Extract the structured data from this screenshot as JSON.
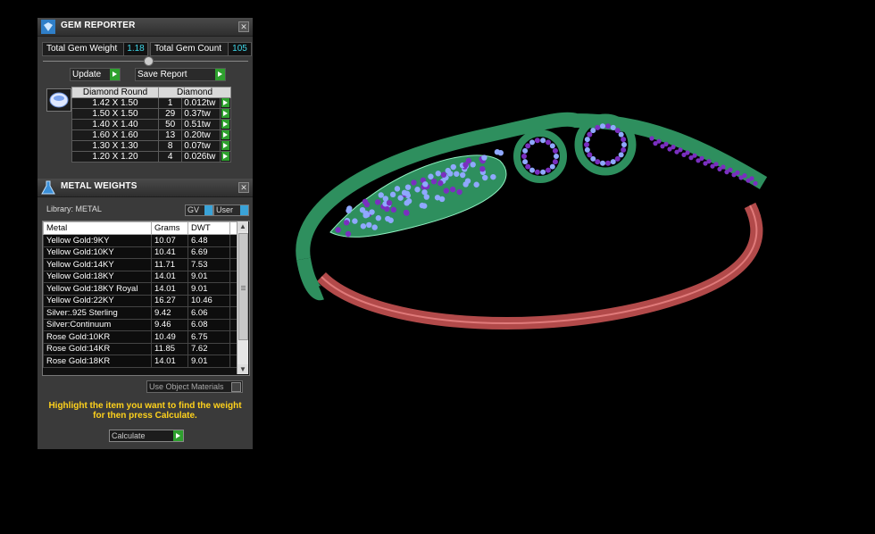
{
  "gem_reporter": {
    "title": "GEM REPORTER",
    "total_weight_label": "Total Gem Weight",
    "total_weight_value": "1.18",
    "total_count_label": "Total Gem Count",
    "total_count_value": "105",
    "update_label": "Update",
    "save_report_label": "Save Report",
    "columns": [
      "Diamond Round",
      "Diamond"
    ],
    "rows": [
      {
        "size": "1.42 X 1.50",
        "count": "1",
        "weight": "0.012tw"
      },
      {
        "size": "1.50 X 1.50",
        "count": "29",
        "weight": "0.37tw"
      },
      {
        "size": "1.40 X 1.40",
        "count": "50",
        "weight": "0.51tw"
      },
      {
        "size": "1.60 X 1.60",
        "count": "13",
        "weight": "0.20tw"
      },
      {
        "size": "1.30 X 1.30",
        "count": "8",
        "weight": "0.07tw"
      },
      {
        "size": "1.20 X 1.20",
        "count": "4",
        "weight": "0.026tw"
      }
    ]
  },
  "metal_weights": {
    "title": "METAL WEIGHTS",
    "library_label": "Library: METAL",
    "gv_label": "GV",
    "user_label": "User",
    "columns": [
      "Metal",
      "Grams",
      "DWT"
    ],
    "rows": [
      {
        "metal": "Yellow Gold:9KY",
        "grams": "10.07",
        "dwt": "6.48"
      },
      {
        "metal": "Yellow Gold:10KY",
        "grams": "10.41",
        "dwt": "6.69"
      },
      {
        "metal": "Yellow Gold:14KY",
        "grams": "11.71",
        "dwt": "7.53"
      },
      {
        "metal": "Yellow Gold:18KY",
        "grams": "14.01",
        "dwt": "9.01"
      },
      {
        "metal": "Yellow Gold:18KY Royal",
        "grams": "14.01",
        "dwt": "9.01"
      },
      {
        "metal": "Yellow Gold:22KY",
        "grams": "16.27",
        "dwt": "10.46"
      },
      {
        "metal": "Silver:.925 Sterling",
        "grams": "9.42",
        "dwt": "6.06"
      },
      {
        "metal": "Silver:Continuum",
        "grams": "9.46",
        "dwt": "6.08"
      },
      {
        "metal": "Rose Gold:10KR",
        "grams": "10.49",
        "dwt": "6.75"
      },
      {
        "metal": "Rose Gold:14KR",
        "grams": "11.85",
        "dwt": "7.62"
      },
      {
        "metal": "Rose Gold:18KR",
        "grams": "14.01",
        "dwt": "9.01"
      }
    ],
    "use_object_materials_label": "Use Object Materials",
    "hint": "Highlight the item you want to find the weight for then press Calculate.",
    "calculate_label": "Calculate"
  },
  "colors": {
    "accent_cyan": "#3fd6e8",
    "go_green": "#2ea02e",
    "hint_yellow": "#ffd21c",
    "metal_green": "#2e8f5e",
    "inner_red": "#b24a4a",
    "gem_blue": "#8fa8ff",
    "gem_purple": "#7a2fc0"
  }
}
